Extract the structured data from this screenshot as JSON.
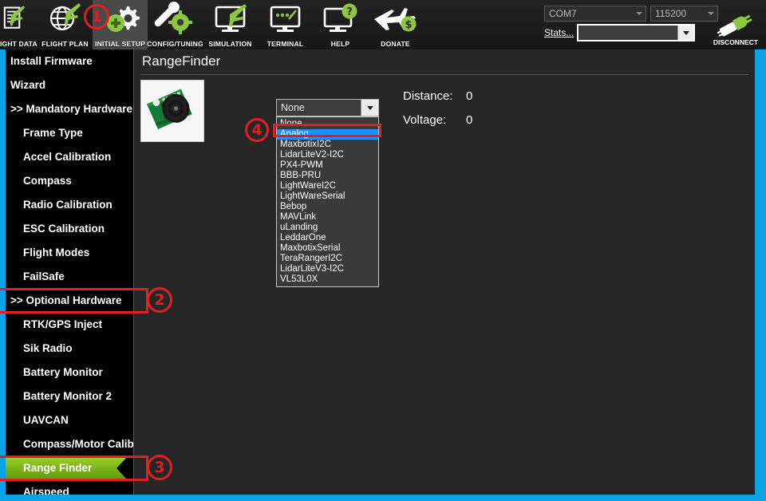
{
  "toolbar": {
    "tabs": [
      {
        "label": "FLIGHT DATA",
        "icon": "flight-data-icon",
        "selected": false
      },
      {
        "label": "FLIGHT PLAN",
        "icon": "flight-plan-icon",
        "selected": false
      },
      {
        "label": "INITIAL SETUP",
        "icon": "initial-setup-icon",
        "selected": true
      },
      {
        "label": "CONFIG/TUNING",
        "icon": "config-tuning-icon",
        "selected": false
      },
      {
        "label": "SIMULATION",
        "icon": "simulation-icon",
        "selected": false
      },
      {
        "label": "TERMINAL",
        "icon": "terminal-icon",
        "selected": false
      },
      {
        "label": "HELP",
        "icon": "help-icon",
        "selected": false
      },
      {
        "label": "DONATE",
        "icon": "donate-icon",
        "selected": false
      }
    ]
  },
  "connection": {
    "com_port": "COM7",
    "baud_rate": "115200",
    "stats_label": "Stats...",
    "link_combo_value": "",
    "disconnect_label": "DISCONNECT"
  },
  "sidebar": {
    "items": [
      {
        "label": "Install Firmware",
        "level": 0,
        "active": false
      },
      {
        "label": "Wizard",
        "level": 0,
        "active": false
      },
      {
        "label": ">> Mandatory Hardware",
        "level": 0,
        "active": false
      },
      {
        "label": "Frame Type",
        "level": 1,
        "active": false
      },
      {
        "label": "Accel Calibration",
        "level": 1,
        "active": false
      },
      {
        "label": "Compass",
        "level": 1,
        "active": false
      },
      {
        "label": "Radio Calibration",
        "level": 1,
        "active": false
      },
      {
        "label": "ESC Calibration",
        "level": 1,
        "active": false
      },
      {
        "label": "Flight Modes",
        "level": 1,
        "active": false
      },
      {
        "label": "FailSafe",
        "level": 1,
        "active": false
      },
      {
        "label": ">> Optional Hardware",
        "level": 0,
        "active": false
      },
      {
        "label": "RTK/GPS Inject",
        "level": 1,
        "active": false
      },
      {
        "label": "Sik Radio",
        "level": 1,
        "active": false
      },
      {
        "label": "Battery Monitor",
        "level": 1,
        "active": false
      },
      {
        "label": "Battery Monitor 2",
        "level": 1,
        "active": false
      },
      {
        "label": "UAVCAN",
        "level": 1,
        "active": false
      },
      {
        "label": "Compass/Motor Calib",
        "level": 1,
        "active": false
      },
      {
        "label": "Range Finder",
        "level": 1,
        "active": true
      },
      {
        "label": "Airspeed",
        "level": 1,
        "active": false
      }
    ]
  },
  "main": {
    "page_title": "RangeFinder",
    "sensor_image_alt": "ultrasonic-rangefinder-board",
    "distance_label": "Distance:",
    "distance_value": "0",
    "voltage_label": "Voltage:",
    "voltage_value": "0",
    "rangefinder_select": {
      "value": "None",
      "selected_option": "Analog",
      "options": [
        "None",
        "Analog",
        "MaxbotixI2C",
        "LidarLiteV2-I2C",
        "PX4-PWM",
        "BBB-PRU",
        "LightWareI2C",
        "LightWareSerial",
        "Bebop",
        "MAVLink",
        "uLanding",
        "LeddarOne",
        "MaxbotixSerial",
        "TeraRangerI2C",
        "LidarLiteV3-I2C",
        "VL53L0X"
      ]
    }
  },
  "annotations": {
    "markers": [
      {
        "number": "1",
        "target": "initial-setup-tab"
      },
      {
        "number": "2",
        "target": "optional-hardware-item"
      },
      {
        "number": "3",
        "target": "range-finder-item"
      },
      {
        "number": "4",
        "target": "analog-option"
      }
    ]
  },
  "colors": {
    "accent_blue": "#0aa3e6",
    "annotation_red": "#e02020",
    "active_green": "#7cb518",
    "selection_blue": "#1e90ff",
    "panel_bg": "#262626"
  }
}
